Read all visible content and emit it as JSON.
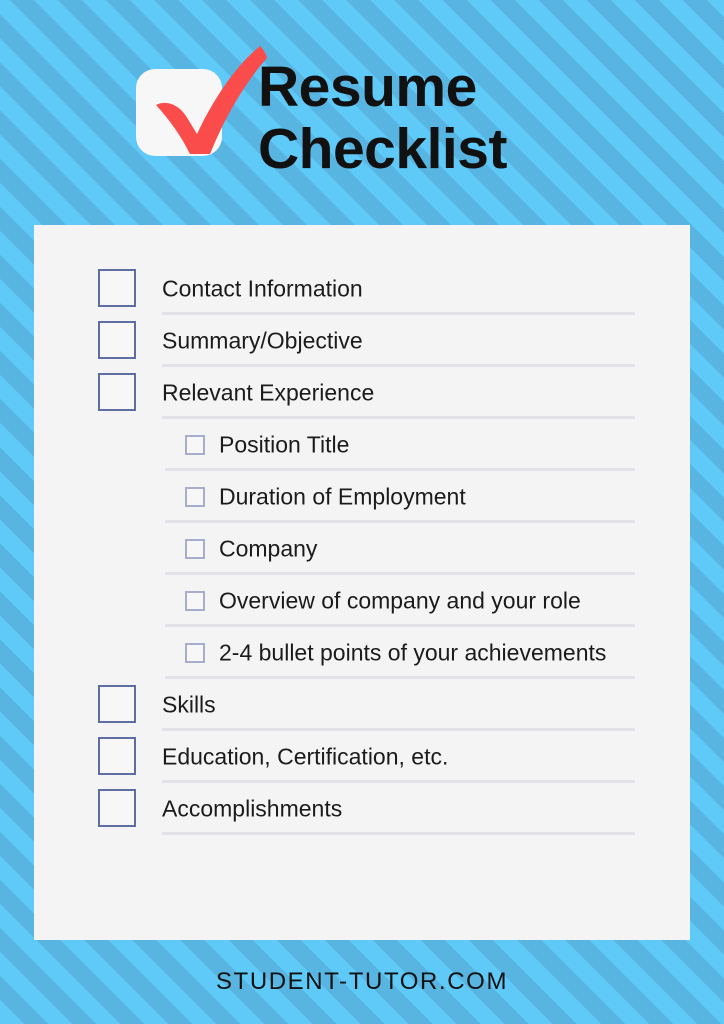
{
  "header": {
    "title_line1": "Resume",
    "title_line2": "Checklist",
    "logo_icon": "check-mark-icon",
    "logo_bg_color": "#f7f7f7",
    "check_color": "#fb4c4c"
  },
  "theme": {
    "background_light": "#5fc9f8",
    "background_dark": "#58b4e0",
    "card_background": "#f4f4f5",
    "divider_color": "#e2e2e8",
    "checkbox_border_main": "#5f6ea0",
    "checkbox_border_sub": "#a6aecb",
    "text_color": "#1b1b1b"
  },
  "checklist": {
    "items": [
      {
        "label": "Contact Information",
        "level": 1,
        "checked": false
      },
      {
        "label": "Summary/Objective",
        "level": 1,
        "checked": false
      },
      {
        "label": "Relevant Experience",
        "level": 1,
        "checked": false
      },
      {
        "label": "Position Title",
        "level": 2,
        "checked": false
      },
      {
        "label": "Duration of Employment",
        "level": 2,
        "checked": false
      },
      {
        "label": "Company",
        "level": 2,
        "checked": false
      },
      {
        "label": "Overview of company and your role",
        "level": 2,
        "checked": false
      },
      {
        "label": "2-4 bullet points of your achievements",
        "level": 2,
        "checked": false
      },
      {
        "label": "Skills",
        "level": 1,
        "checked": false
      },
      {
        "label": "Education, Certification, etc.",
        "level": 1,
        "checked": false
      },
      {
        "label": "Accomplishments",
        "level": 1,
        "checked": false
      }
    ]
  },
  "footer": {
    "text": "STUDENT-TUTOR.COM"
  }
}
